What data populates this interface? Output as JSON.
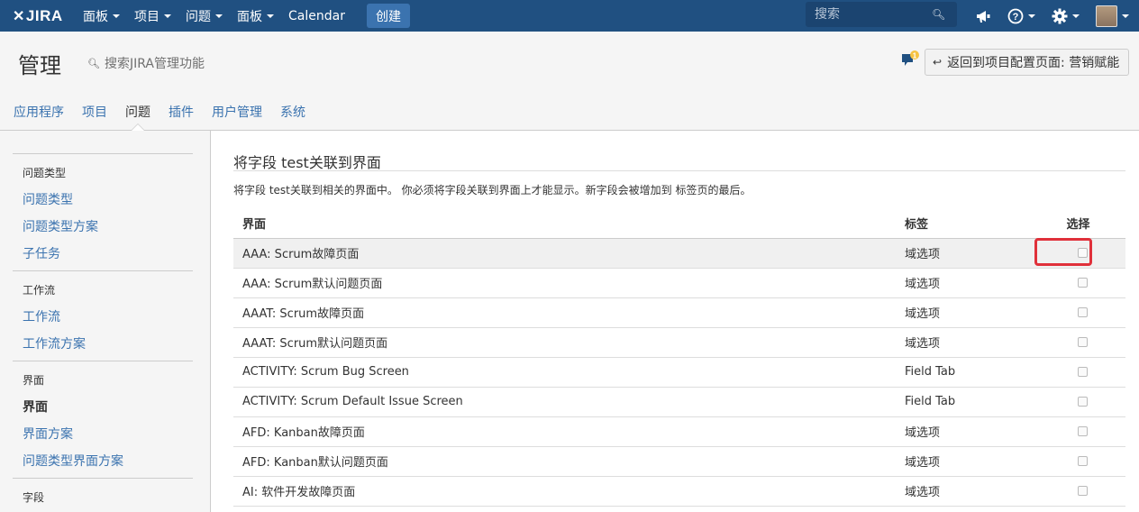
{
  "topnav": {
    "logo_text": "JIRA",
    "items": [
      {
        "label": "面板",
        "has_caret": true
      },
      {
        "label": "项目",
        "has_caret": true
      },
      {
        "label": "问题",
        "has_caret": true
      },
      {
        "label": "面板",
        "has_caret": true
      },
      {
        "label": "Calendar",
        "has_caret": false
      }
    ],
    "create_label": "创建",
    "search_placeholder": "搜索",
    "icons": [
      "megaphone-icon",
      "help-icon",
      "gear-icon",
      "avatar"
    ]
  },
  "header": {
    "title": "管理",
    "admin_search_label": "搜索JIRA管理功能",
    "notification_count": "1",
    "back_button_label": "返回到项目配置页面: 营销赋能"
  },
  "admin_tabs": [
    {
      "label": "应用程序",
      "active": false
    },
    {
      "label": "项目",
      "active": false
    },
    {
      "label": "问题",
      "active": true
    },
    {
      "label": "插件",
      "active": false
    },
    {
      "label": "用户管理",
      "active": false
    },
    {
      "label": "系统",
      "active": false
    }
  ],
  "sidebar": {
    "sections": [
      {
        "heading": "问题类型",
        "links": [
          "问题类型",
          "问题类型方案",
          "子任务"
        ]
      },
      {
        "heading": "工作流",
        "links": [
          "工作流",
          "工作流方案"
        ]
      },
      {
        "heading": "界面",
        "links": [
          "界面",
          "界面方案",
          "问题类型界面方案"
        ]
      },
      {
        "heading": "字段",
        "links": []
      }
    ],
    "current_link": "界面"
  },
  "main": {
    "title": "将字段 test关联到界面",
    "description": "将字段 test关联到相关的界面中。 你必须将字段关联到界面上才能显示。新字段会被增加到 标签页的最后。",
    "columns": {
      "screen": "界面",
      "tab": "标签",
      "select": "选择"
    },
    "rows": [
      {
        "screen": "AAA: Scrum故障页面",
        "tab": "域选项",
        "checked": false
      },
      {
        "screen": "AAA: Scrum默认问题页面",
        "tab": "域选项",
        "checked": false
      },
      {
        "screen": "AAAT: Scrum故障页面",
        "tab": "域选项",
        "checked": false
      },
      {
        "screen": "AAAT: Scrum默认问题页面",
        "tab": "域选项",
        "checked": false
      },
      {
        "screen": "ACTIVITY: Scrum Bug Screen",
        "tab": "Field Tab",
        "checked": false
      },
      {
        "screen": "ACTIVITY: Scrum Default Issue Screen",
        "tab": "Field Tab",
        "checked": false
      },
      {
        "screen": "AFD: Kanban故障页面",
        "tab": "域选项",
        "checked": false
      },
      {
        "screen": "AFD: Kanban默认问题页面",
        "tab": "域选项",
        "checked": false
      },
      {
        "screen": "AI: 软件开发故障页面",
        "tab": "域选项",
        "checked": false
      }
    ]
  },
  "colors": {
    "nav_bg": "#205081",
    "link": "#3b73af",
    "highlight_box": "#e0303a",
    "notification_badge": "#f6c342"
  }
}
